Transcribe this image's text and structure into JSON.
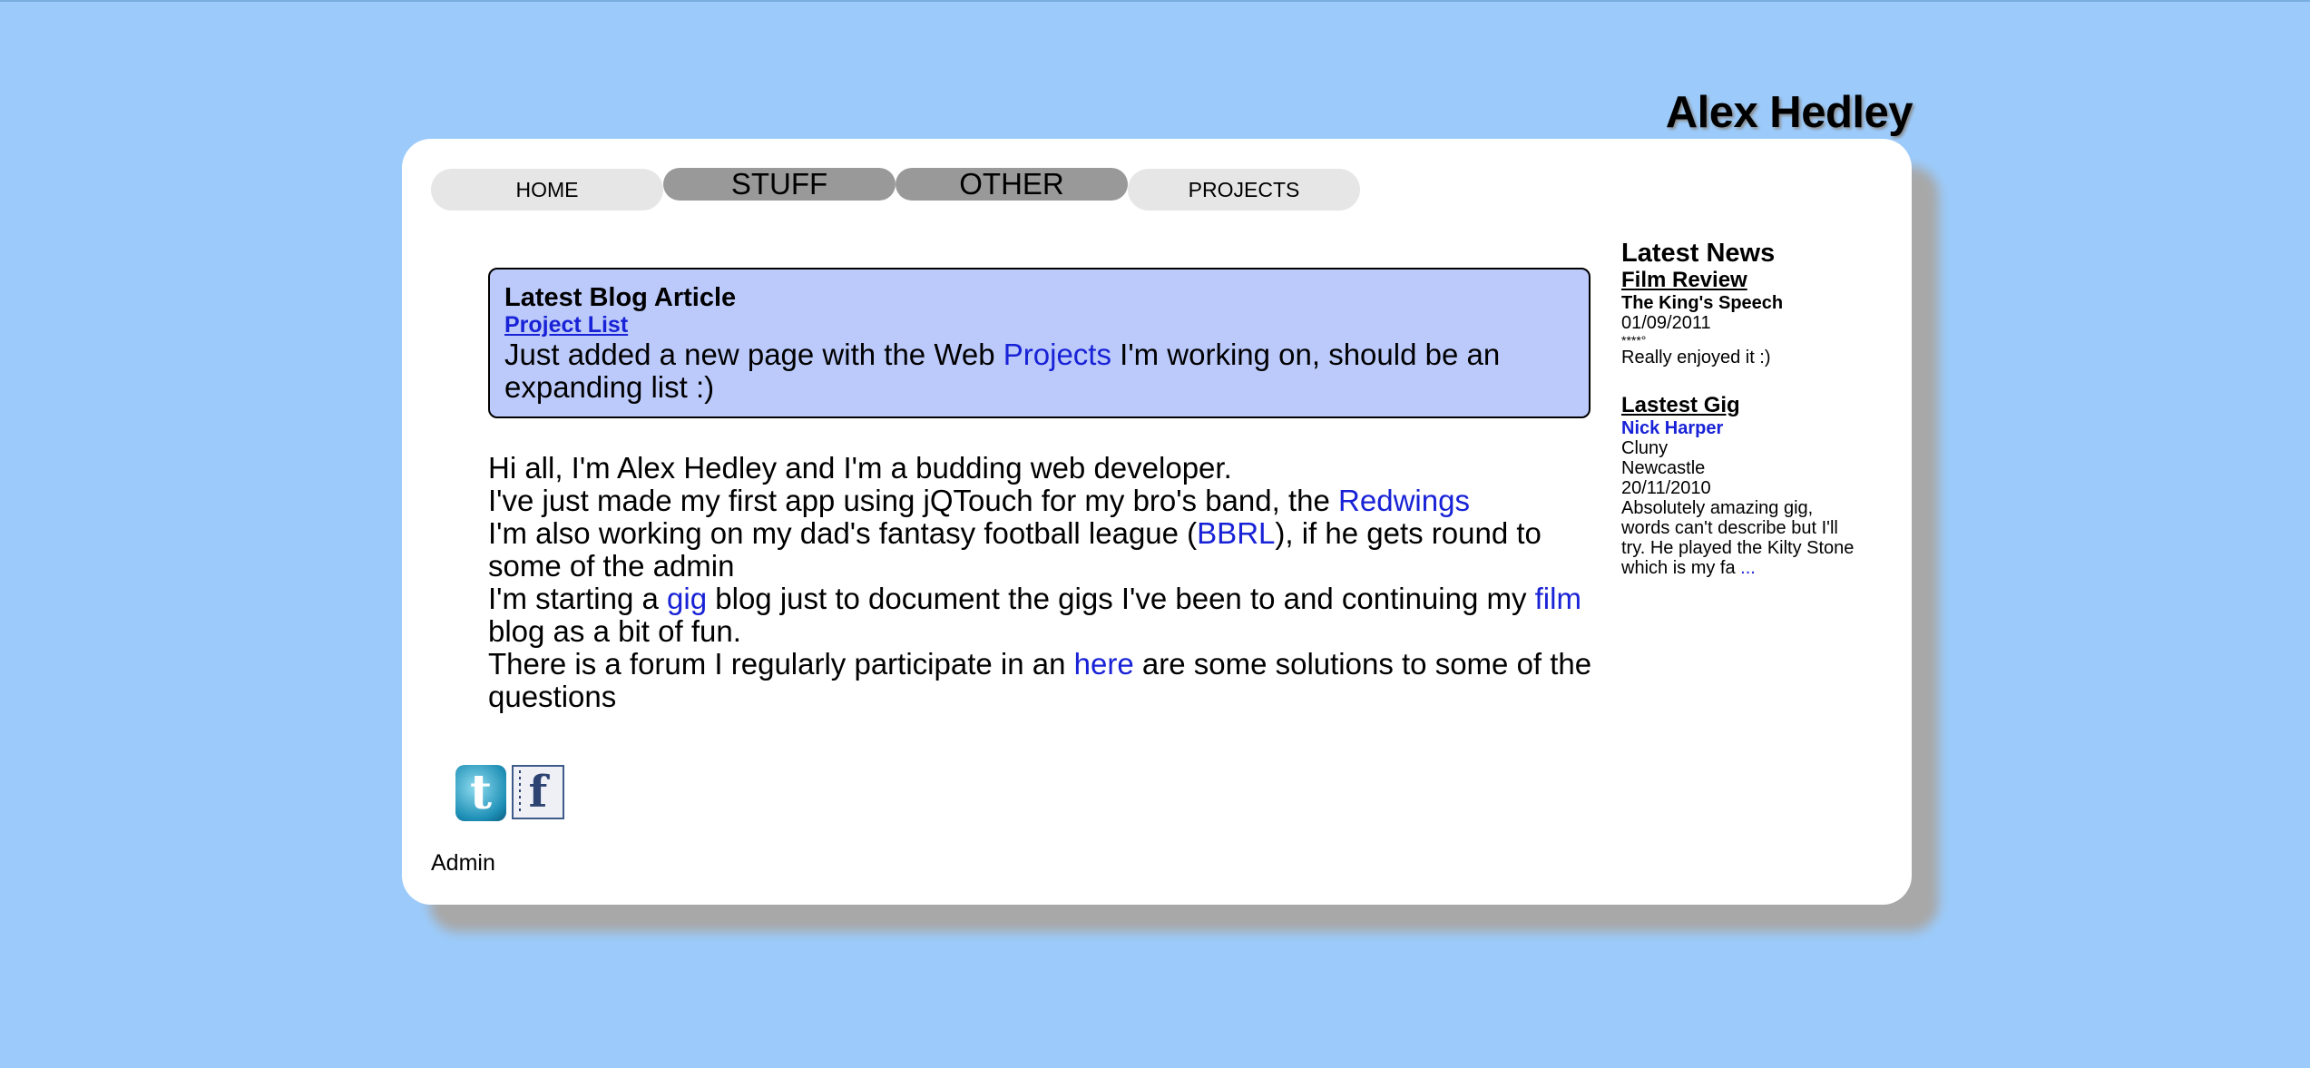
{
  "site": {
    "title": "Alex Hedley"
  },
  "nav": [
    {
      "label": "HOME"
    },
    {
      "label": "STUFF"
    },
    {
      "label": "OTHER"
    },
    {
      "label": "PROJECTS"
    }
  ],
  "blog": {
    "heading": "Latest Blog Article",
    "link": "Project List",
    "text_before": "Just added a new page with the Web ",
    "text_link": "Projects",
    "text_after": " I'm working on, should be an expanding list :)"
  },
  "intro": {
    "line1": "Hi all, I'm Alex Hedley and I'm a budding web developer.",
    "line2_before": "I've just made my first app using jQTouch for my bro's band, the ",
    "line2_link": "Redwings",
    "line3_before": "I'm also working on my dad's fantasy football league (",
    "line3_link": "BBRL",
    "line3_after": "), if he gets round to some of the admin",
    "line4_before": "I'm starting a ",
    "line4_link1": "gig",
    "line4_mid": " blog just to document the gigs I've been to and continuing my ",
    "line4_link2": "film",
    "line4_after": " blog as a bit of fun.",
    "line5_before": "There is a forum I regularly participate in an ",
    "line5_link": "here",
    "line5_after": " are some solutions to some of the questions"
  },
  "news": {
    "heading": "Latest News",
    "film": {
      "title": "Film Review",
      "name": "The King's Speech",
      "date": "01/09/2011",
      "rating": "****°",
      "comment": "Really enjoyed it :)"
    },
    "gig": {
      "title": "Lastest Gig",
      "artist": "Nick Harper",
      "venue": "Cluny",
      "city": "Newcastle",
      "date": "20/11/2010",
      "excerpt": "Absolutely amazing gig, words can't describe but I'll try. He played the Kilty Stone which is my fa ",
      "more": "..."
    }
  },
  "social": {
    "twitter_glyph": "t",
    "facebook_glyph": "f"
  },
  "footer": {
    "admin": "Admin"
  }
}
